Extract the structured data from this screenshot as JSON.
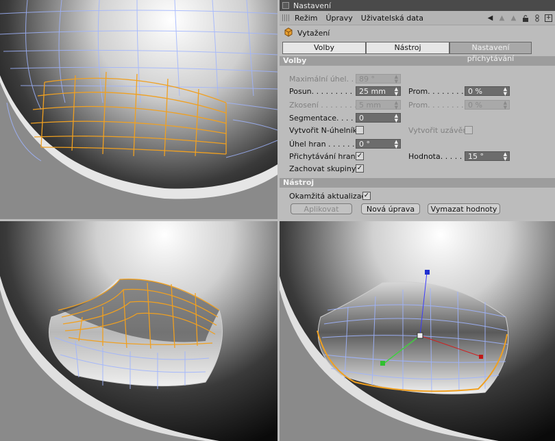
{
  "window": {
    "title": "Nastavení"
  },
  "menu": {
    "items": [
      "Režim",
      "Úpravy",
      "Uživatelská data"
    ]
  },
  "toolbar": {
    "icons": [
      "arrow-left-icon",
      "arrow-up-icon",
      "lock-icon",
      "link-icon",
      "new-window-icon"
    ]
  },
  "object": {
    "name": "Vytažení",
    "icon": "extrude-cube-icon"
  },
  "tabs": [
    {
      "label": "Volby",
      "active": true
    },
    {
      "label": "Nástroj",
      "active": true
    },
    {
      "label": "Nastavení přichytávání",
      "active": false
    }
  ],
  "volby": {
    "header": "Volby",
    "max_angle": {
      "label": "Maximální úhel. . .",
      "value": "89 °",
      "enabled": false
    },
    "posun": {
      "label": "Posun. . . . . . . . .",
      "value": "25 mm",
      "enabled": true
    },
    "prom1": {
      "label": "Prom. . . . . . . . . .",
      "value": "0 %",
      "enabled": true
    },
    "zkoseni": {
      "label": "Zkosení . . . . . . . .",
      "value": "5 mm",
      "enabled": false
    },
    "prom2": {
      "label": "Prom. . . . . . . . . .",
      "value": "0 %",
      "enabled": false
    },
    "segmentace": {
      "label": "Segmentace. . . . . .",
      "value": "0",
      "enabled": true
    },
    "ngons": {
      "label": "Vytvořit N-úhelníky",
      "checked": false
    },
    "caps": {
      "label": "Vytvořit uzávěry",
      "checked": false,
      "enabled": false
    },
    "edge_angle": {
      "label": "Úhel hran . . . . . . .",
      "value": "0 °",
      "enabled": true
    },
    "edge_snap": {
      "label": "Přichytávání hran",
      "checked": true
    },
    "hodnota": {
      "label": "Hodnota. . . . . .",
      "value": "15 °",
      "enabled": true
    },
    "keep_groups": {
      "label": "Zachovat skupiny",
      "checked": true
    }
  },
  "nastroj": {
    "header": "Nástroj",
    "realtime": {
      "label": "Okamžitá aktualizace",
      "checked": true
    },
    "apply_label": "Aplikovat",
    "new_edit_label": "Nová úprava",
    "clear_label": "Vymazat hodnoty"
  },
  "colors": {
    "panel_bg": "#bcbcbc",
    "section_bg": "#9d9d9d",
    "field_bg": "#6c6c6c",
    "wire": "#9fb4ff",
    "selection": "#f0a020"
  }
}
